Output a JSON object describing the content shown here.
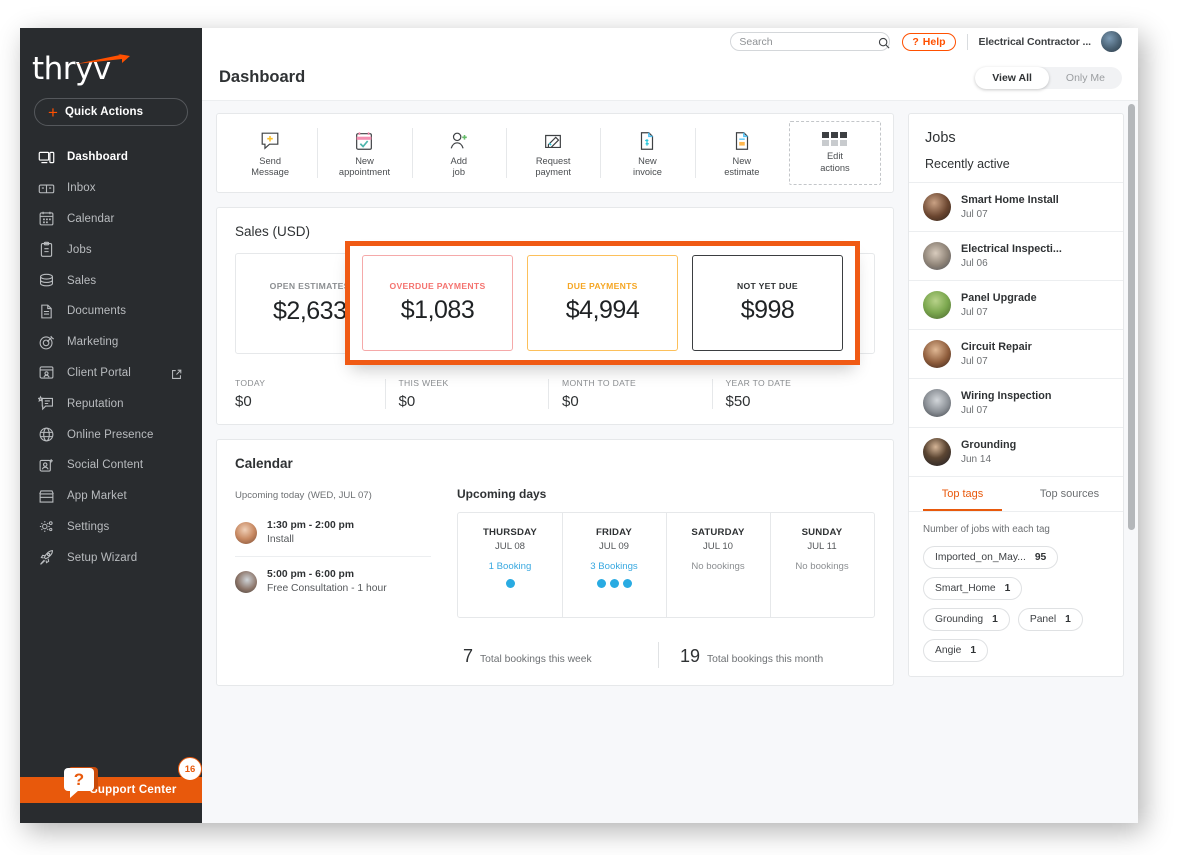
{
  "brand": {
    "name": "thryv",
    "accent": "#ff5000",
    "sidebar_bg": "#292c2f"
  },
  "sidebar": {
    "quick_actions_label": "Quick Actions",
    "items": [
      {
        "label": "Dashboard",
        "icon": "dashboard-icon",
        "active": true
      },
      {
        "label": "Inbox",
        "icon": "inbox-icon",
        "active": false
      },
      {
        "label": "Calendar",
        "icon": "calendar-icon",
        "active": false
      },
      {
        "label": "Jobs",
        "icon": "clipboard-icon",
        "active": false
      },
      {
        "label": "Sales",
        "icon": "coins-icon",
        "active": false
      },
      {
        "label": "Documents",
        "icon": "document-icon",
        "active": false
      },
      {
        "label": "Marketing",
        "icon": "target-icon",
        "active": false
      },
      {
        "label": "Client Portal",
        "icon": "portal-icon",
        "external": true,
        "active": false
      },
      {
        "label": "Reputation",
        "icon": "review-icon",
        "active": false
      },
      {
        "label": "Online Presence",
        "icon": "globe-icon",
        "active": false
      },
      {
        "label": "Social Content",
        "icon": "social-icon",
        "active": false
      },
      {
        "label": "App Market",
        "icon": "store-icon",
        "active": false
      },
      {
        "label": "Settings",
        "icon": "gear-icon",
        "active": false
      },
      {
        "label": "Setup Wizard",
        "icon": "rocket-icon",
        "active": false
      }
    ],
    "support": {
      "label": "Support Center",
      "badge": "16"
    }
  },
  "topbar": {
    "search_placeholder": "Search",
    "search_value": "",
    "help_label": "Help",
    "account_name": "Electrical Contractor ..."
  },
  "pagehead": {
    "title": "Dashboard",
    "view_all": "View All",
    "only_me": "Only Me"
  },
  "quick_action_strip": {
    "actions": [
      {
        "line1": "Send",
        "line2": "Message",
        "icon": "message-plus-icon"
      },
      {
        "line1": "New",
        "line2": "appointment",
        "icon": "calendar-check-icon"
      },
      {
        "line1": "Add",
        "line2": "job",
        "icon": "user-plus-icon"
      },
      {
        "line1": "Request",
        "line2": "payment",
        "icon": "request-payment-icon"
      },
      {
        "line1": "New",
        "line2": "invoice",
        "icon": "invoice-icon"
      },
      {
        "line1": "New",
        "line2": "estimate",
        "icon": "estimate-icon"
      }
    ],
    "edit": {
      "line1": "Edit",
      "line2": "actions",
      "icon": "grid-dots-icon"
    }
  },
  "sales": {
    "title": "Sales",
    "title_suffix": "(USD)",
    "open_estimates": {
      "label": "OPEN ESTIMATES",
      "value": "$2,633"
    },
    "highlight": {
      "border_color": "#f05a14",
      "boxes": [
        {
          "label": "OVERDUE PAYMENTS",
          "value": "$1,083",
          "style": "overdue",
          "color": "#f4736f"
        },
        {
          "label": "DUE PAYMENTS",
          "value": "$4,994",
          "style": "due",
          "color": "#f5a623"
        },
        {
          "label": "NOT YET DUE",
          "value": "$998",
          "style": "notdue",
          "color": "#2f3234"
        }
      ]
    },
    "periods": [
      {
        "label": "TODAY",
        "value": "$0"
      },
      {
        "label": "THIS WEEK",
        "value": "$0"
      },
      {
        "label": "MONTH TO DATE",
        "value": "$0"
      },
      {
        "label": "YEAR TO DATE",
        "value": "$50"
      }
    ]
  },
  "calendar": {
    "title": "Calendar",
    "upcoming_today_title": "Upcoming today",
    "upcoming_today_date": "(WED, JUL 07)",
    "appointments": [
      {
        "time": "1:30 pm - 2:00 pm",
        "desc": "Install"
      },
      {
        "time": "5:00 pm - 6:00 pm",
        "desc": "Free Consultation - 1 hour"
      }
    ],
    "upcoming_days_title": "Upcoming days",
    "days": [
      {
        "name": "THURSDAY",
        "date": "JUL 08",
        "bookings_text": "1 Booking",
        "dots": 1,
        "has_bookings": true
      },
      {
        "name": "FRIDAY",
        "date": "JUL 09",
        "bookings_text": "3 Bookings",
        "dots": 3,
        "has_bookings": true
      },
      {
        "name": "SATURDAY",
        "date": "JUL 10",
        "bookings_text": "No bookings",
        "dots": 0,
        "has_bookings": false
      },
      {
        "name": "SUNDAY",
        "date": "JUL 11",
        "bookings_text": "No bookings",
        "dots": 0,
        "has_bookings": false
      }
    ],
    "totals": [
      {
        "number": "7",
        "text": "Total bookings this week"
      },
      {
        "number": "19",
        "text": "Total bookings this month"
      }
    ]
  },
  "jobs": {
    "title": "Jobs",
    "subtitle": "Recently active",
    "rows": [
      {
        "name": "Smart Home Install",
        "date": "Jul 07"
      },
      {
        "name": "Electrical Inspecti...",
        "date": "Jul 06"
      },
      {
        "name": "Panel Upgrade",
        "date": "Jul 07"
      },
      {
        "name": "Circuit Repair",
        "date": "Jul 07"
      },
      {
        "name": "Wiring Inspection",
        "date": "Jul 07"
      },
      {
        "name": "Grounding",
        "date": "Jun 14"
      }
    ],
    "tabs": [
      {
        "label": "Top tags",
        "active": true
      },
      {
        "label": "Top sources",
        "active": false
      }
    ],
    "tags_note": "Number of jobs with each tag",
    "tags": [
      {
        "label": "Imported_on_May...",
        "count": "95"
      },
      {
        "label": "Smart_Home",
        "count": "1"
      },
      {
        "label": "Grounding",
        "count": "1"
      },
      {
        "label": "Panel",
        "count": "1"
      },
      {
        "label": "Angie",
        "count": "1"
      }
    ]
  }
}
